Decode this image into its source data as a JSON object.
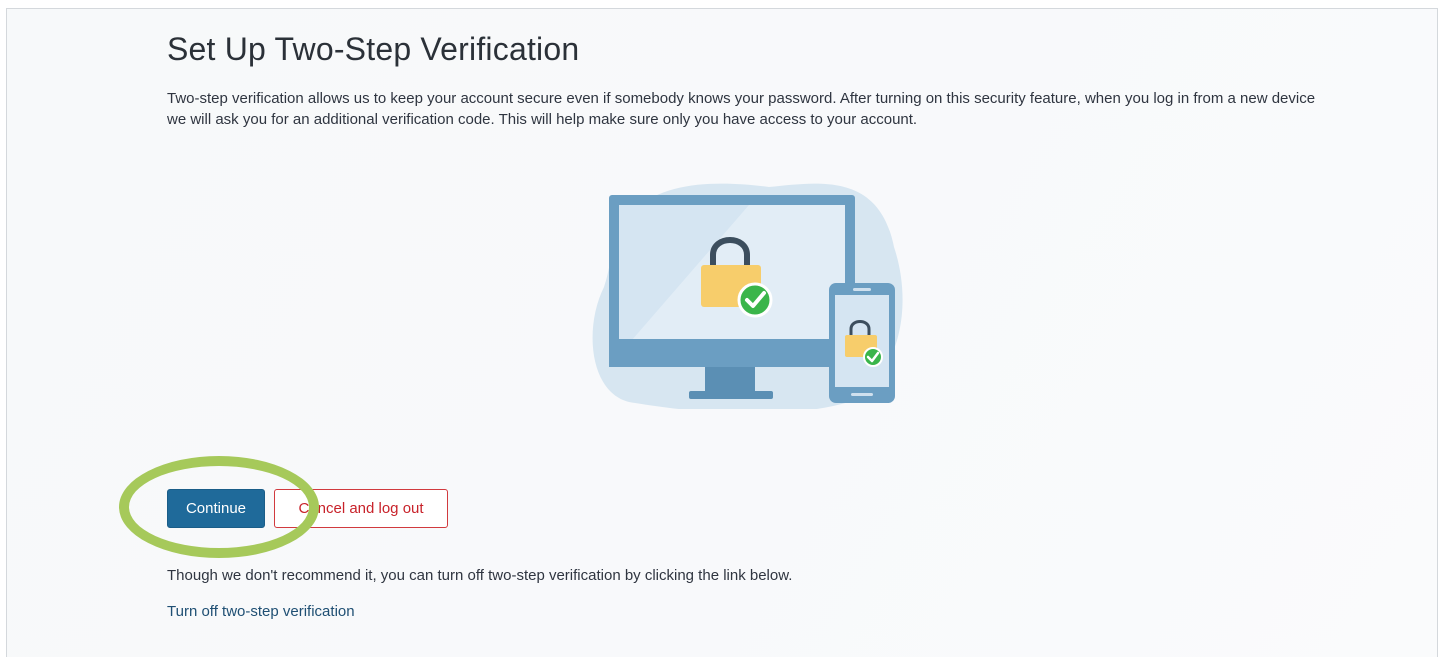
{
  "page": {
    "title": "Set Up Two-Step Verification",
    "description": "Two-step verification allows us to keep your account secure even if somebody knows your password. After turning on this security feature, when you log in from a new device we will ask you for an additional verification code. This will help make sure only you have access to your account."
  },
  "illustration": {
    "icons": [
      "monitor-icon",
      "padlock-icon",
      "check-badge-icon",
      "phone-icon"
    ]
  },
  "actions": {
    "continue_label": "Continue",
    "cancel_label": "Cancel and log out"
  },
  "footer": {
    "note": "Though we don't recommend it, you can turn off two-step verification by clicking the link below.",
    "turn_off_link": "Turn off two-step verification"
  },
  "colors": {
    "primary": "#1f6a9a",
    "danger": "#c8222a",
    "highlight": "#a6c95a",
    "success": "#3ab54a",
    "lock": "#f7cd6b"
  }
}
